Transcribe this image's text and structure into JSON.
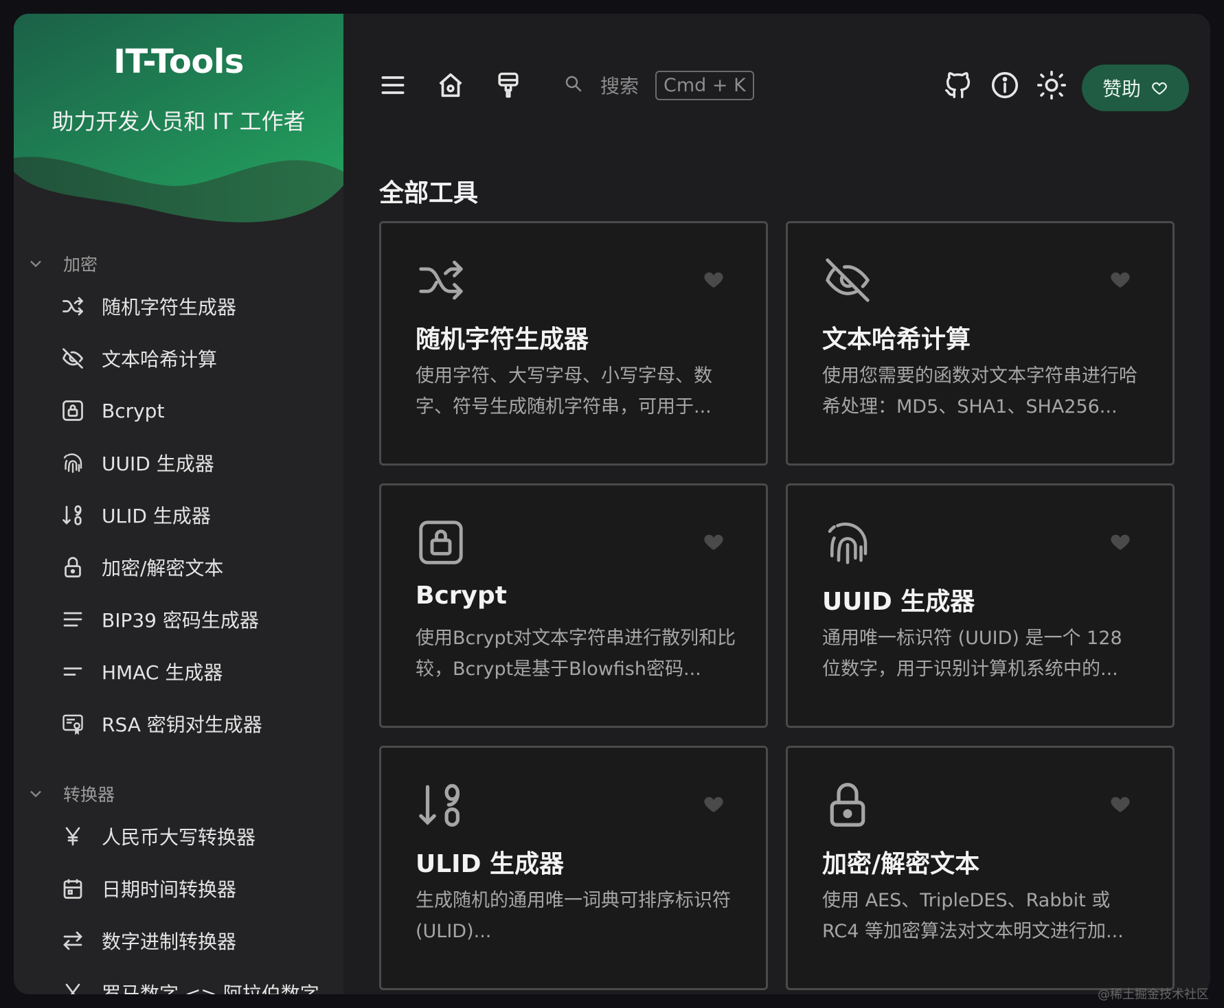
{
  "app": {
    "title": "IT-Tools",
    "subtitle": "助力开发人员和 IT 工作者"
  },
  "sidebar": {
    "groups": [
      {
        "label": "加密",
        "items": [
          {
            "label": "随机字符生成器",
            "icon": "shuffle-icon"
          },
          {
            "label": "文本哈希计算",
            "icon": "eye-off-icon"
          },
          {
            "label": "Bcrypt",
            "icon": "lock-square-icon"
          },
          {
            "label": "UUID 生成器",
            "icon": "fingerprint-icon"
          },
          {
            "label": "ULID 生成器",
            "icon": "sort-numeric-icon"
          },
          {
            "label": "加密/解密文本",
            "icon": "lock-icon"
          },
          {
            "label": "BIP39 密码生成器",
            "icon": "align-justify-icon"
          },
          {
            "label": "HMAC 生成器",
            "icon": "short-text-icon"
          },
          {
            "label": "RSA 密钥对生成器",
            "icon": "certificate-icon"
          }
        ]
      },
      {
        "label": "转换器",
        "items": [
          {
            "label": "人民币大写转换器",
            "icon": "yen-icon"
          },
          {
            "label": "日期时间转换器",
            "icon": "calendar-icon"
          },
          {
            "label": "数字进制转换器",
            "icon": "arrows-left-right-icon"
          },
          {
            "label": "罗马数字 <> 阿拉伯数字",
            "icon": "letter-x-icon"
          }
        ]
      }
    ]
  },
  "topbar": {
    "search_label": "搜索",
    "search_shortcut": "Cmd + K",
    "sponsor_label": "赞助"
  },
  "main": {
    "section_title": "全部工具",
    "cards": [
      {
        "title": "随机字符生成器",
        "desc": "使用字符、大写字母、小写字母、数字、符号生成随机字符串，可用于...",
        "icon": "shuffle-icon"
      },
      {
        "title": "文本哈希计算",
        "desc": "使用您需要的函数对文本字符串进行哈希处理：MD5、SHA1、SHA256...",
        "icon": "eye-off-icon"
      },
      {
        "title": "Bcrypt",
        "desc": "使用Bcrypt对文本字符串进行散列和比较，Bcrypt是基于Blowfish密码...",
        "icon": "lock-square-icon"
      },
      {
        "title": "UUID 生成器",
        "desc": "通用唯一标识符 (UUID) 是一个 128 位数字，用于识别计算机系统中的...",
        "icon": "fingerprint-icon"
      },
      {
        "title": "ULID 生成器",
        "desc": "生成随机的通用唯一词典可排序标识符 (ULID)...",
        "icon": "sort-numeric-icon"
      },
      {
        "title": "加密/解密文本",
        "desc": "使用 AES、TripleDES、Rabbit 或 RC4 等加密算法对文本明文进行加...",
        "icon": "lock-icon"
      }
    ]
  },
  "watermark": "@稀土掘金技术社区",
  "colors": {
    "accent": "#1f5c43",
    "hero_dark": "#1c6a4a",
    "hero_light": "#2aa863"
  }
}
